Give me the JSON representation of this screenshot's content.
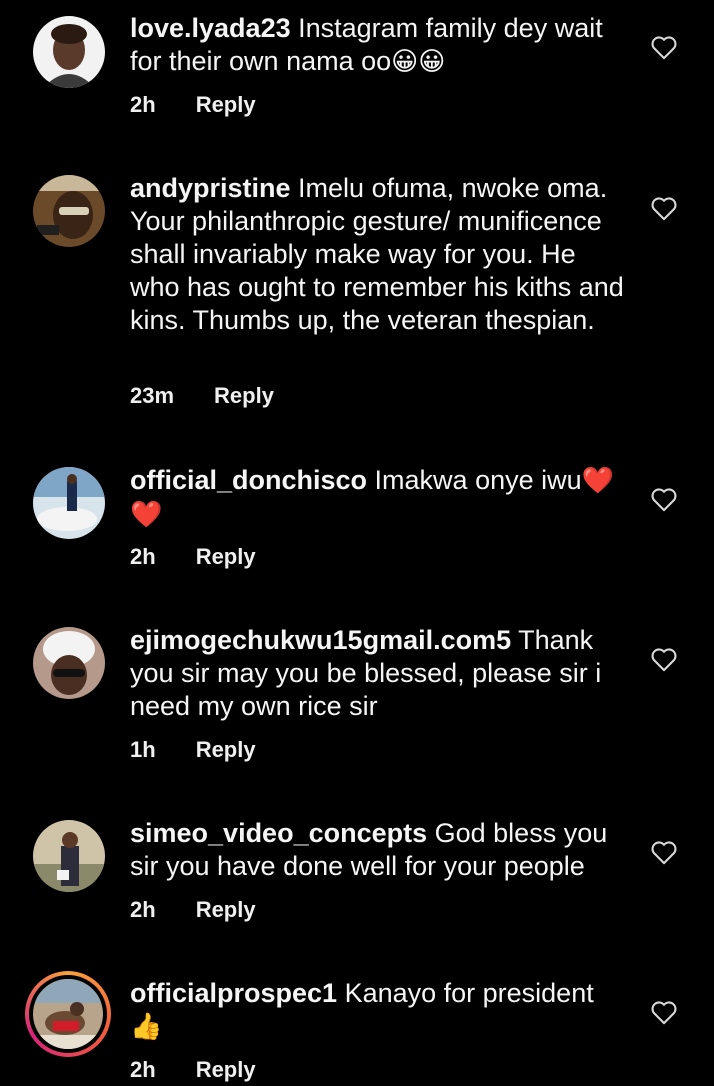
{
  "comments": [
    {
      "username": "love.lyada23",
      "text": " Instagram family dey wait for their own nama oo",
      "emoji": "😀😀",
      "time": "2h",
      "reply": "Reply"
    },
    {
      "username": "andypristine",
      "text": " Imelu ofuma, nwoke oma. Your philanthropic gesture/ munificence shall invariably make way for you. He who has ought to remember his kiths and kins. Thumbs up, the veteran thespian.",
      "emoji": "",
      "time": "23m",
      "reply": "Reply"
    },
    {
      "username": "official_donchisco",
      "text": " Imakwa onye iwu",
      "emoji": "❤️❤️",
      "time": "2h",
      "reply": "Reply"
    },
    {
      "username": "ejimogechukwu15gmail.com5",
      "text": " Thank you sir may you be blessed, please sir i need my own rice sir",
      "emoji": "",
      "time": "1h",
      "reply": "Reply"
    },
    {
      "username": "simeo_video_concepts",
      "text": " God bless you sir you have done well for your people",
      "emoji": "",
      "time": "2h",
      "reply": "Reply"
    },
    {
      "username": "officialprospec1",
      "text": " Kanayo for president",
      "emoji": "👍",
      "time": "2h",
      "reply": "Reply"
    }
  ],
  "icons": {
    "like": "heart-outline-icon"
  },
  "colors": {
    "background": "#000000",
    "text": "#f5f5f5",
    "story_ring": "#d6247a"
  }
}
